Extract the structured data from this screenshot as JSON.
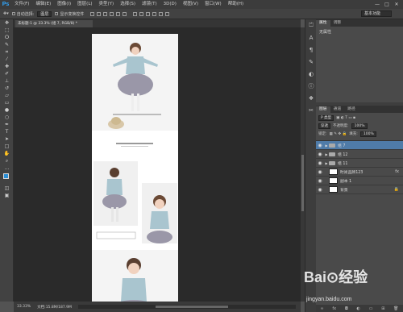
{
  "app": {
    "logo": "Ps"
  },
  "menu": [
    "文件(F)",
    "编辑(E)",
    "图像(I)",
    "图层(L)",
    "类型(Y)",
    "选择(S)",
    "滤镜(T)",
    "3D(D)",
    "视图(V)",
    "窗口(W)",
    "帮助(H)"
  ],
  "window_controls": [
    "—",
    "□",
    "✕"
  ],
  "options_bar": {
    "auto_select": "自动选择:",
    "auto_select_value": "图层",
    "show_transform": "显示变换控件",
    "workspace": "基本功能"
  },
  "document_tab": "未标题-1 @ 33.3% (组 7, RGB/8) *",
  "status": {
    "zoom": "33.33%",
    "doc": "文档:15.8M/187.9M"
  },
  "properties_panel": {
    "tabs": [
      "属性",
      "调整"
    ],
    "content": "无属性"
  },
  "layers_panel": {
    "tabs": [
      "图层",
      "通道",
      "路径"
    ],
    "kind": "P 类型",
    "blend_mode": "穿透",
    "opacity_label": "不透明度:",
    "opacity": "100%",
    "lock_label": "锁定:",
    "fill_label": "填充:",
    "fill": "100%",
    "layers": [
      {
        "name": "组 7",
        "type": "group",
        "selected": true,
        "fx": ""
      },
      {
        "name": "组 12",
        "type": "group",
        "selected": false,
        "fx": ""
      },
      {
        "name": "组 11",
        "type": "group",
        "selected": false,
        "fx": ""
      },
      {
        "name": "时尚品牌123",
        "type": "layer",
        "selected": false,
        "fx": "fx"
      },
      {
        "name": "副本 1",
        "type": "layer",
        "selected": false,
        "fx": ""
      },
      {
        "name": "背景",
        "type": "background",
        "selected": false,
        "fx": ""
      }
    ]
  },
  "watermark": {
    "text": "Bai⊙经验",
    "url": "jingyan.baidu.com"
  }
}
